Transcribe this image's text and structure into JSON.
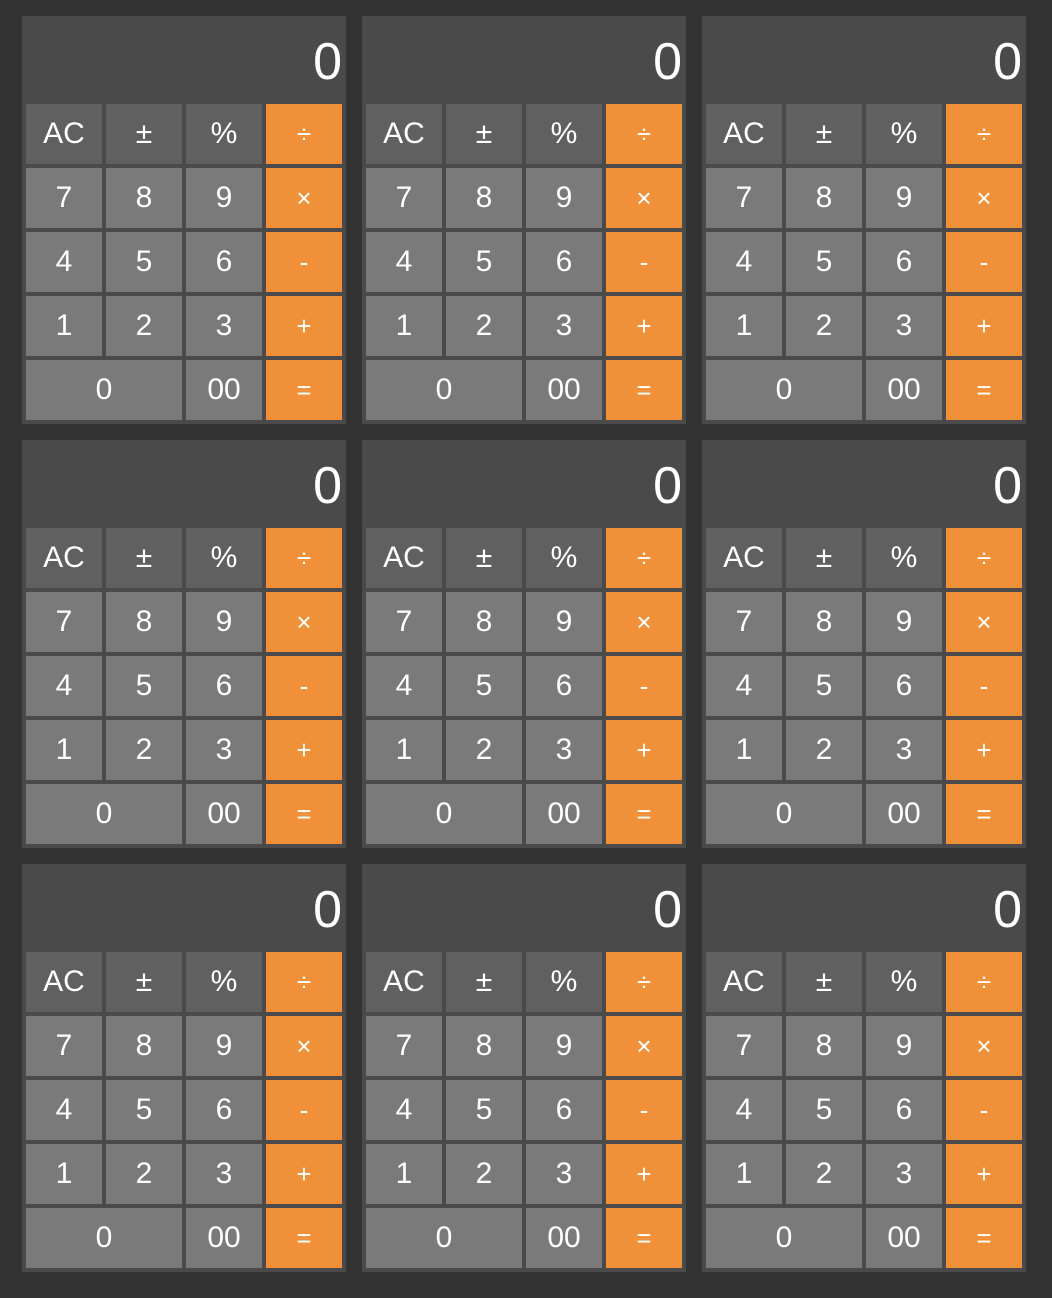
{
  "display_value": "0",
  "keys": {
    "ac": "AC",
    "plus_minus": "±",
    "percent": "%",
    "divide": "÷",
    "seven": "7",
    "eight": "8",
    "nine": "9",
    "multiply": "×",
    "four": "4",
    "five": "5",
    "six": "6",
    "minus": "-",
    "one": "1",
    "two": "2",
    "three": "3",
    "plus": "+",
    "zero": "0",
    "double_zero": "00",
    "equals": "="
  },
  "colors": {
    "background": "#333333",
    "panel": "#4a4a4a",
    "function_key": "#606060",
    "digit_key": "#7a7a7a",
    "operator_key": "#f0913a",
    "text": "#ffffff"
  }
}
